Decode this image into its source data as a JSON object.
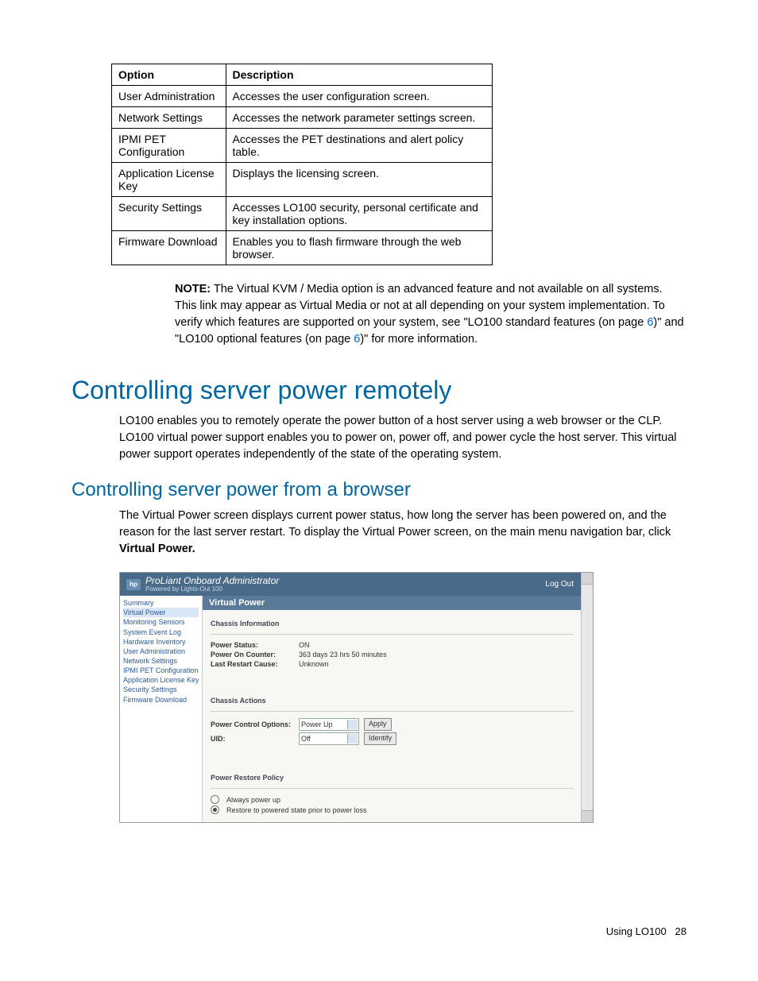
{
  "table": {
    "headers": [
      "Option",
      "Description"
    ],
    "rows": [
      {
        "opt": "User Administration",
        "desc": "Accesses the user configuration screen."
      },
      {
        "opt": "Network Settings",
        "desc": "Accesses the network parameter settings screen."
      },
      {
        "opt": "IPMI PET Configuration",
        "desc": "Accesses the PET destinations and alert policy table."
      },
      {
        "opt": "Application License Key",
        "desc": "Displays the licensing screen."
      },
      {
        "opt": "Security Settings",
        "desc": "Accesses LO100 security, personal certificate and key installation options."
      },
      {
        "opt": "Firmware Download",
        "desc": "Enables you to flash firmware through the web browser."
      }
    ]
  },
  "note": {
    "label": "NOTE:",
    "text1": "  The Virtual KVM / Media option is an advanced feature and not available on all systems. This link may appear as Virtual Media or not at all depending on your system implementation. To verify which features are supported on your system, see \"LO100 standard features (on page ",
    "link1": "6",
    "text2": ")\" and \"LO100 optional features (on page ",
    "link2": "6",
    "text3": ")\" for more information."
  },
  "h1": "Controlling server power remotely",
  "p1": "LO100 enables you to remotely operate the power button of a host server using a web browser or the CLP. LO100 virtual power support enables you to power on, power off, and power cycle the host server. This virtual power support operates independently of the state of the operating system.",
  "h2": "Controlling server power from a browser",
  "p2a": "The Virtual Power screen displays current power status, how long the server has been powered on, and the reason for the last server restart. To display the Virtual Power screen, on the main menu navigation bar, click ",
  "p2b": "Virtual Power.",
  "ss": {
    "brand_title": "ProLiant Onboard Administrator",
    "brand_sub": "Powered by Lights-Out 100",
    "logout": "Log Out",
    "nav": [
      "Summary",
      "Virtual Power",
      "Monitoring Sensors",
      "System Event Log",
      "Hardware Inventory",
      "User Administration",
      "Network Settings",
      "IPMI PET Configuration",
      "Application License Key",
      "Security Settings",
      "Firmware Download"
    ],
    "panel_title": "Virtual Power",
    "sect1": "Chassis Information",
    "power_status_lbl": "Power Status:",
    "power_status_val": "ON",
    "power_on_lbl": "Power On Counter:",
    "power_on_val": "363 days 23 hrs 50 minutes",
    "restart_lbl": "Last Restart Cause:",
    "restart_val": "Unknown",
    "sect2": "Chassis Actions",
    "pco_lbl": "Power Control Options:",
    "pco_val": "Power Up",
    "apply": "Apply",
    "uid_lbl": "UID:",
    "uid_val": "Off",
    "identify": "Identify",
    "sect3": "Power Restore Policy",
    "radio1": "Always power up",
    "radio2": "Restore to powered state prior to power loss"
  },
  "footer_text": "Using LO100",
  "footer_page": "28"
}
